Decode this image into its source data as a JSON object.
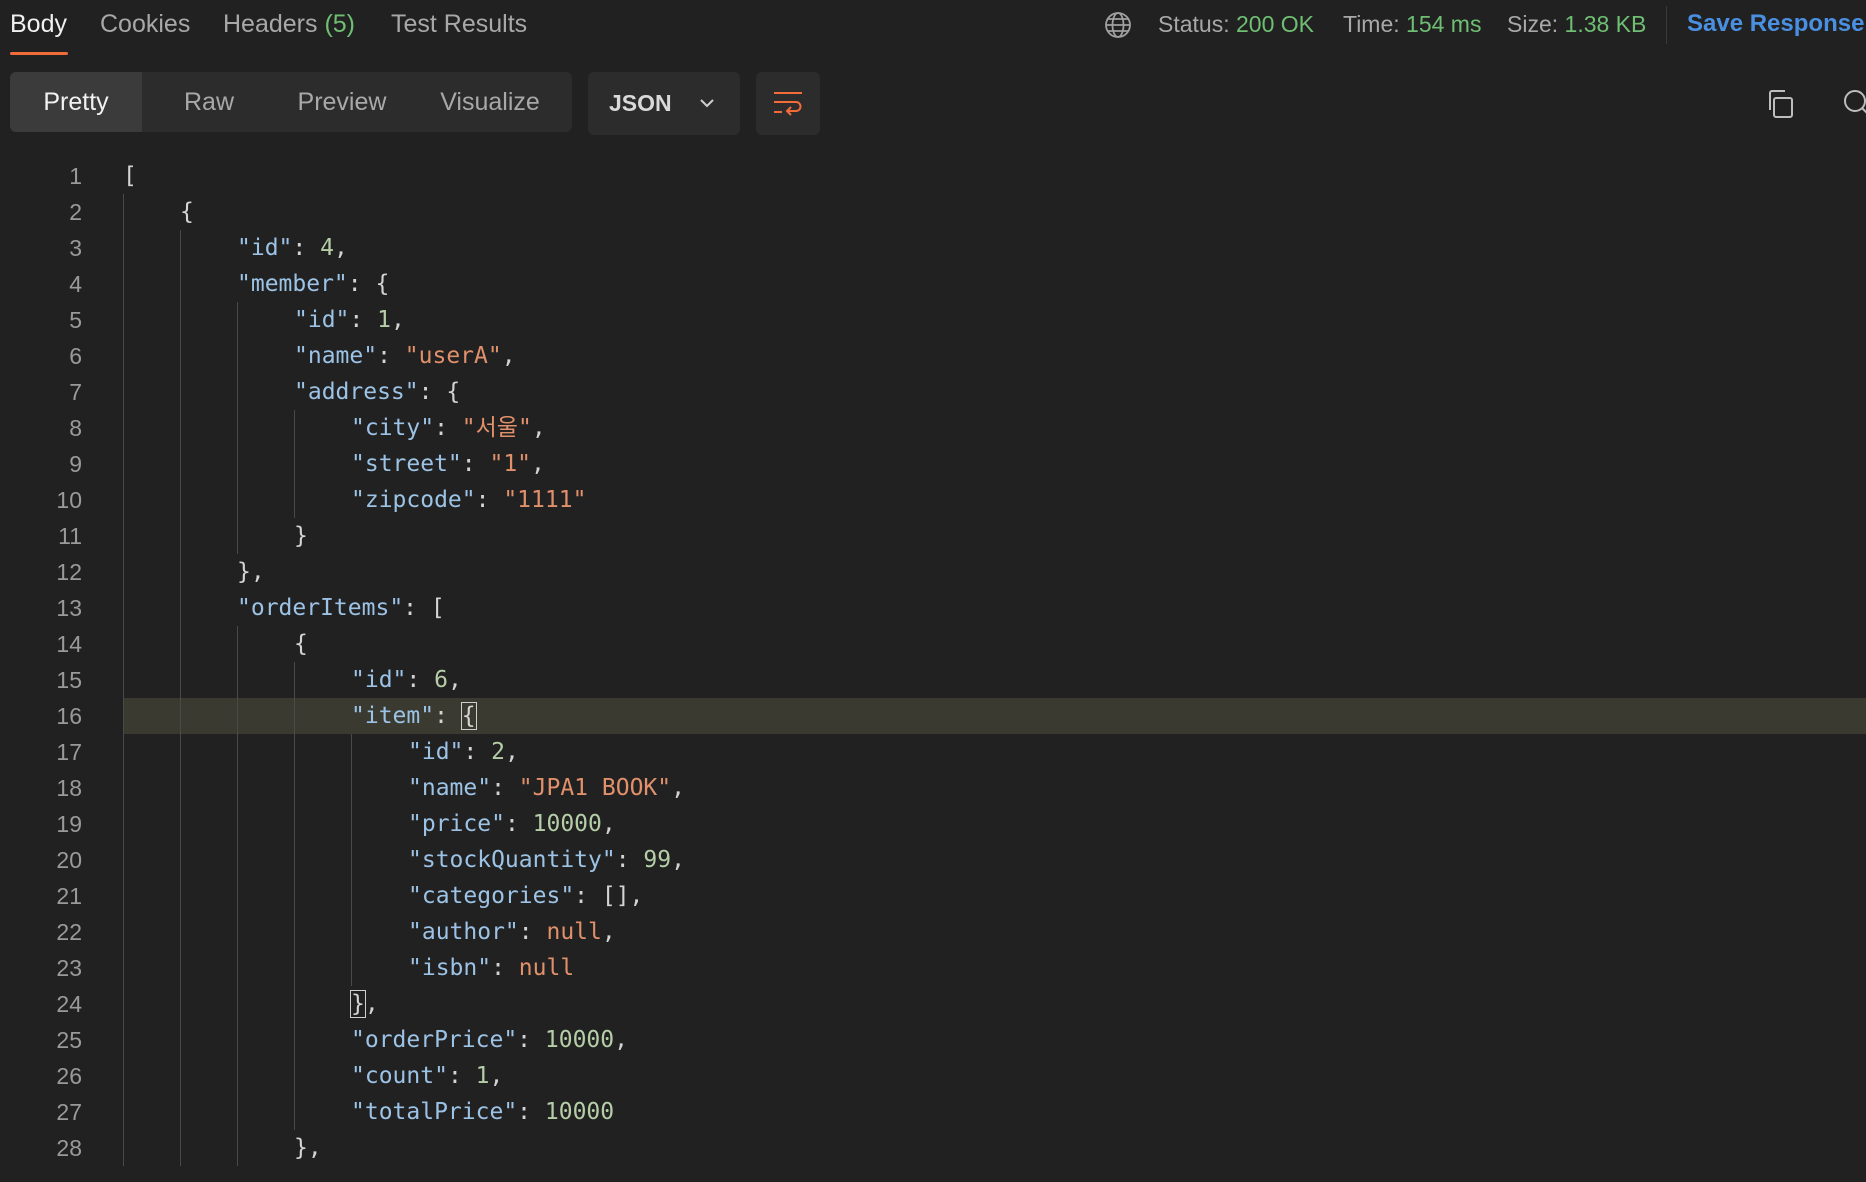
{
  "tabs": [
    {
      "label": "Body",
      "count": ""
    },
    {
      "label": "Cookies",
      "count": ""
    },
    {
      "label": "Headers",
      "count": "(5)"
    },
    {
      "label": "Test Results",
      "count": ""
    }
  ],
  "status": {
    "status_label": "Status:",
    "status_value": "200 OK",
    "time_label": "Time:",
    "time_value": "154 ms",
    "size_label": "Size:",
    "size_value": "1.38 KB"
  },
  "save_label": "Save Response",
  "view_modes": [
    "Pretty",
    "Raw",
    "Preview",
    "Visualize"
  ],
  "format_select": "JSON",
  "code_lines": [
    {
      "n": "1",
      "indent": 0,
      "tokens": [
        [
          "p",
          "["
        ]
      ]
    },
    {
      "n": "2",
      "indent": 1,
      "tokens": [
        [
          "p",
          "{"
        ]
      ]
    },
    {
      "n": "3",
      "indent": 2,
      "tokens": [
        [
          "k",
          "\"id\""
        ],
        [
          "p",
          ": "
        ],
        [
          "n",
          "4"
        ],
        [
          "p",
          ","
        ]
      ]
    },
    {
      "n": "4",
      "indent": 2,
      "tokens": [
        [
          "k",
          "\"member\""
        ],
        [
          "p",
          ": {"
        ]
      ]
    },
    {
      "n": "5",
      "indent": 3,
      "tokens": [
        [
          "k",
          "\"id\""
        ],
        [
          "p",
          ": "
        ],
        [
          "n",
          "1"
        ],
        [
          "p",
          ","
        ]
      ]
    },
    {
      "n": "6",
      "indent": 3,
      "tokens": [
        [
          "k",
          "\"name\""
        ],
        [
          "p",
          ": "
        ],
        [
          "s",
          "\"userA\""
        ],
        [
          "p",
          ","
        ]
      ]
    },
    {
      "n": "7",
      "indent": 3,
      "tokens": [
        [
          "k",
          "\"address\""
        ],
        [
          "p",
          ": {"
        ]
      ]
    },
    {
      "n": "8",
      "indent": 4,
      "tokens": [
        [
          "k",
          "\"city\""
        ],
        [
          "p",
          ": "
        ],
        [
          "s",
          "\"서울\""
        ],
        [
          "p",
          ","
        ]
      ]
    },
    {
      "n": "9",
      "indent": 4,
      "tokens": [
        [
          "k",
          "\"street\""
        ],
        [
          "p",
          ": "
        ],
        [
          "s",
          "\"1\""
        ],
        [
          "p",
          ","
        ]
      ]
    },
    {
      "n": "10",
      "indent": 4,
      "tokens": [
        [
          "k",
          "\"zipcode\""
        ],
        [
          "p",
          ": "
        ],
        [
          "s",
          "\"1111\""
        ]
      ]
    },
    {
      "n": "11",
      "indent": 3,
      "tokens": [
        [
          "p",
          "}"
        ]
      ]
    },
    {
      "n": "12",
      "indent": 2,
      "tokens": [
        [
          "p",
          "},"
        ]
      ]
    },
    {
      "n": "13",
      "indent": 2,
      "tokens": [
        [
          "k",
          "\"orderItems\""
        ],
        [
          "p",
          ": ["
        ]
      ]
    },
    {
      "n": "14",
      "indent": 3,
      "tokens": [
        [
          "p",
          "{"
        ]
      ]
    },
    {
      "n": "15",
      "indent": 4,
      "tokens": [
        [
          "k",
          "\"id\""
        ],
        [
          "p",
          ": "
        ],
        [
          "n",
          "6"
        ],
        [
          "p",
          ","
        ]
      ]
    },
    {
      "n": "16",
      "indent": 4,
      "tokens": [
        [
          "k",
          "\"item\""
        ],
        [
          "p",
          ": "
        ],
        [
          "b",
          "{"
        ]
      ]
    },
    {
      "n": "17",
      "indent": 5,
      "tokens": [
        [
          "k",
          "\"id\""
        ],
        [
          "p",
          ": "
        ],
        [
          "n",
          "2"
        ],
        [
          "p",
          ","
        ]
      ]
    },
    {
      "n": "18",
      "indent": 5,
      "tokens": [
        [
          "k",
          "\"name\""
        ],
        [
          "p",
          ": "
        ],
        [
          "s",
          "\"JPA1 BOOK\""
        ],
        [
          "p",
          ","
        ]
      ]
    },
    {
      "n": "19",
      "indent": 5,
      "tokens": [
        [
          "k",
          "\"price\""
        ],
        [
          "p",
          ": "
        ],
        [
          "n",
          "10000"
        ],
        [
          "p",
          ","
        ]
      ]
    },
    {
      "n": "20",
      "indent": 5,
      "tokens": [
        [
          "k",
          "\"stockQuantity\""
        ],
        [
          "p",
          ": "
        ],
        [
          "n",
          "99"
        ],
        [
          "p",
          ","
        ]
      ]
    },
    {
      "n": "21",
      "indent": 5,
      "tokens": [
        [
          "k",
          "\"categories\""
        ],
        [
          "p",
          ": [],"
        ]
      ]
    },
    {
      "n": "22",
      "indent": 5,
      "tokens": [
        [
          "k",
          "\"author\""
        ],
        [
          "p",
          ": "
        ],
        [
          "s",
          "null"
        ],
        [
          "p",
          ","
        ]
      ]
    },
    {
      "n": "23",
      "indent": 5,
      "tokens": [
        [
          "k",
          "\"isbn\""
        ],
        [
          "p",
          ": "
        ],
        [
          "s",
          "null"
        ]
      ]
    },
    {
      "n": "24",
      "indent": 4,
      "tokens": [
        [
          "b",
          "}"
        ],
        [
          "p",
          ","
        ]
      ]
    },
    {
      "n": "25",
      "indent": 4,
      "tokens": [
        [
          "k",
          "\"orderPrice\""
        ],
        [
          "p",
          ": "
        ],
        [
          "n",
          "10000"
        ],
        [
          "p",
          ","
        ]
      ]
    },
    {
      "n": "26",
      "indent": 4,
      "tokens": [
        [
          "k",
          "\"count\""
        ],
        [
          "p",
          ": "
        ],
        [
          "n",
          "1"
        ],
        [
          "p",
          ","
        ]
      ]
    },
    {
      "n": "27",
      "indent": 4,
      "tokens": [
        [
          "k",
          "\"totalPrice\""
        ],
        [
          "p",
          ": "
        ],
        [
          "n",
          "10000"
        ]
      ]
    },
    {
      "n": "28",
      "indent": 3,
      "tokens": [
        [
          "p",
          "},"
        ]
      ]
    }
  ],
  "highlighted_line": "16",
  "colors": {
    "accent": "#f26b3a",
    "status_ok": "#6fbf73",
    "link": "#4a90e2",
    "key": "#9cc3e6",
    "string": "#e0906a",
    "number": "#b5cea8"
  }
}
